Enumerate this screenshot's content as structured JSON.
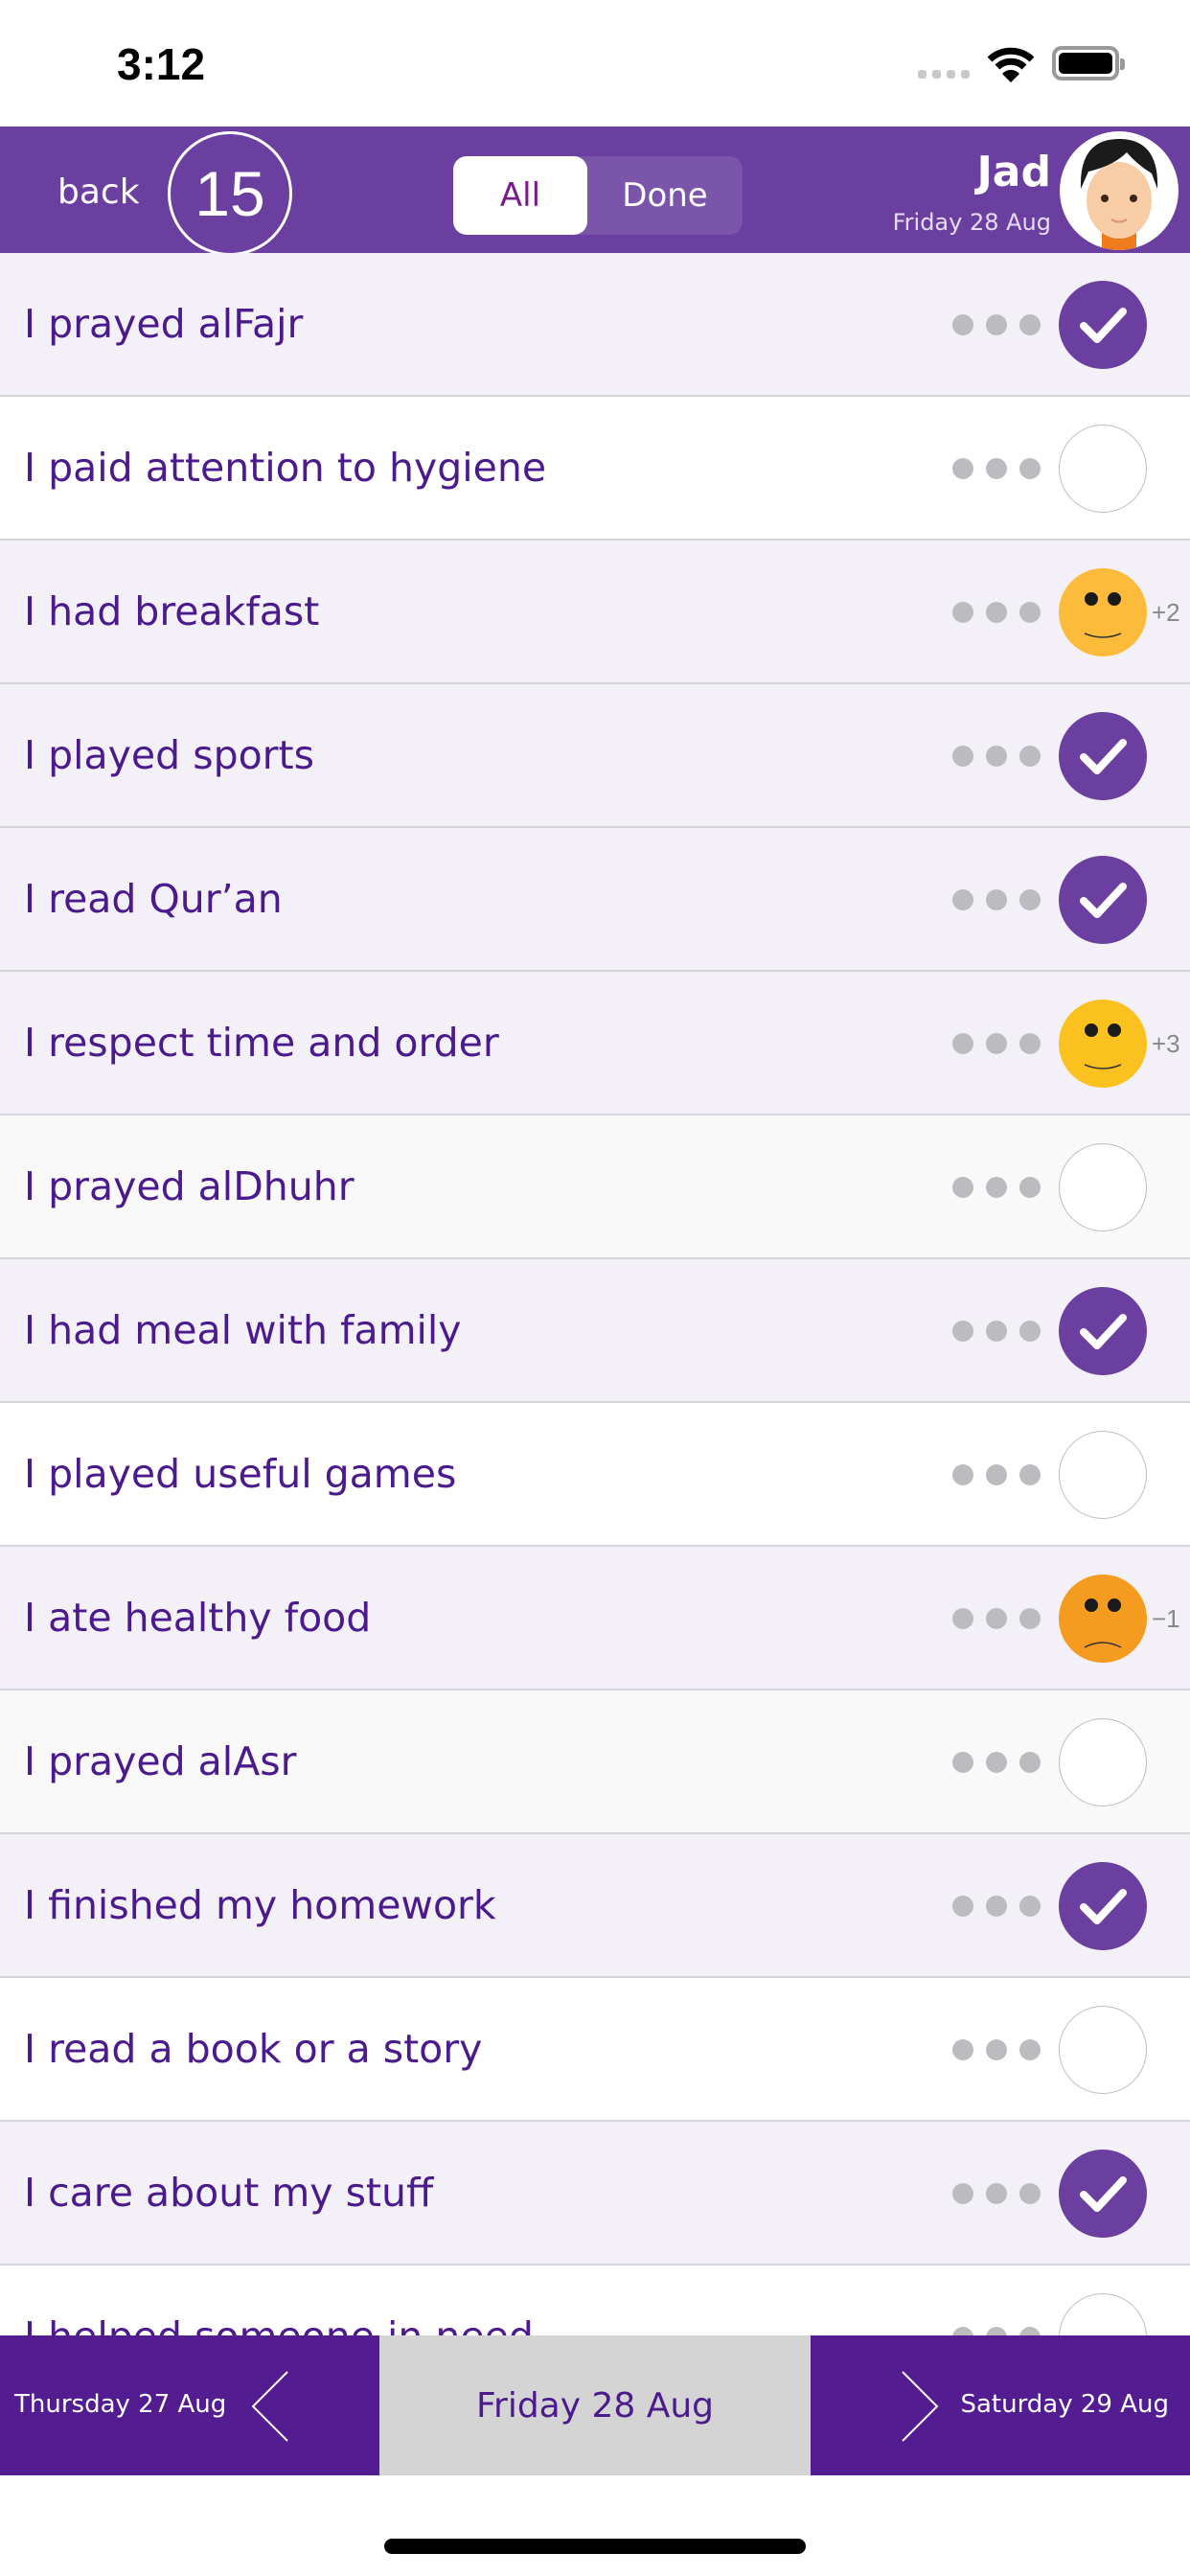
{
  "status_bar": {
    "time": "3:12",
    "icons": [
      "signal-icon",
      "wifi-icon",
      "battery-icon"
    ]
  },
  "header": {
    "back_label": "back",
    "count": "15",
    "tabs": [
      {
        "label": "All",
        "selected": true
      },
      {
        "label": "Done",
        "selected": false
      }
    ],
    "user_name": "Jad",
    "date": "Friday 28 Aug",
    "bg_color": "#6b3fa0"
  },
  "items": [
    {
      "label": "I prayed alFajr",
      "state": "check",
      "bg": "#f3f1f7"
    },
    {
      "label": "I paid attention to hygiene",
      "state": "empty",
      "bg": "#ffffff"
    },
    {
      "label": "I had breakfast",
      "state": "happy",
      "score": "+2",
      "bg": "#f3f1f7"
    },
    {
      "label": "I played sports",
      "state": "check",
      "bg": "#f3f1f7"
    },
    {
      "label": "I read Qur’an",
      "state": "check",
      "bg": "#f3f1f7"
    },
    {
      "label": "I respect time and order",
      "state": "happy-bright",
      "score": "+3",
      "bg": "#f3f1f7"
    },
    {
      "label": "I prayed alDhuhr",
      "state": "empty",
      "bg": "#f9f9f9"
    },
    {
      "label": "I had meal with family",
      "state": "check",
      "bg": "#f3f1f7"
    },
    {
      "label": "I played useful games",
      "state": "empty",
      "bg": "#ffffff"
    },
    {
      "label": "I ate healthy food",
      "state": "sad",
      "score": "−1",
      "bg": "#f3f1f7"
    },
    {
      "label": "I prayed alAsr",
      "state": "empty",
      "bg": "#f9f9f9"
    },
    {
      "label": "I finished my homework",
      "state": "check",
      "bg": "#f3f1f7"
    },
    {
      "label": "I read a book or a story",
      "state": "empty",
      "bg": "#ffffff"
    },
    {
      "label": "I care about my stuff",
      "state": "check",
      "bg": "#f3f1f7"
    },
    {
      "label": "I helped someone in need",
      "state": "empty",
      "bg": "#ffffff"
    }
  ],
  "footer": {
    "prev_day": "Thursday 27 Aug",
    "current_day": "Friday 28 Aug",
    "next_day": "Saturday 29 Aug"
  },
  "colors": {
    "accent": "#6b3fa0",
    "footer": "#531c91",
    "text": "#4b1a8c",
    "happy": "#fdbb3b",
    "happy_bright": "#fbc21f",
    "sad": "#f59b1f"
  }
}
